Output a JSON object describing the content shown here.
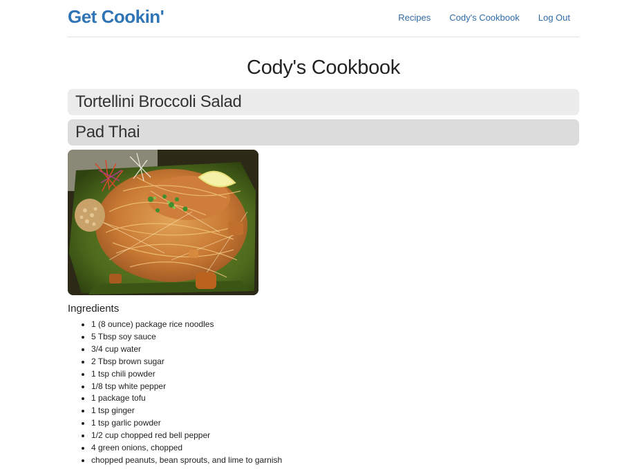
{
  "header": {
    "brand": "Get Cookin'",
    "nav": [
      {
        "label": "Recipes"
      },
      {
        "label": "Cody's Cookbook"
      },
      {
        "label": "Log Out"
      }
    ]
  },
  "page": {
    "title": "Cody's Cookbook"
  },
  "recipes": [
    {
      "title": "Tortellini Broccoli Salad",
      "state": "collapsed"
    },
    {
      "title": "Pad Thai",
      "state": "expanded"
    }
  ],
  "expanded_recipe": {
    "image_icon": "pad-thai-photo",
    "ingredients_heading": "Ingredients",
    "ingredients": [
      "1 (8 ounce) package rice noodles",
      "5 Tbsp soy sauce",
      "3/4 cup water",
      "2 Tbsp brown sugar",
      "1 tsp chili powder",
      "1/8 tsp white pepper",
      "1 package tofu",
      "1 tsp ginger",
      "1 tsp garlic powder",
      "1/2 cup chopped red bell pepper",
      "4 green onions, chopped",
      "chopped peanuts, bean sprouts, and lime to garnish"
    ]
  },
  "colors": {
    "brand": "#2f75b5",
    "nav_link": "#2f6aa6",
    "bar_collapsed": "#ececec",
    "bar_expanded": "#dcdcdc"
  }
}
